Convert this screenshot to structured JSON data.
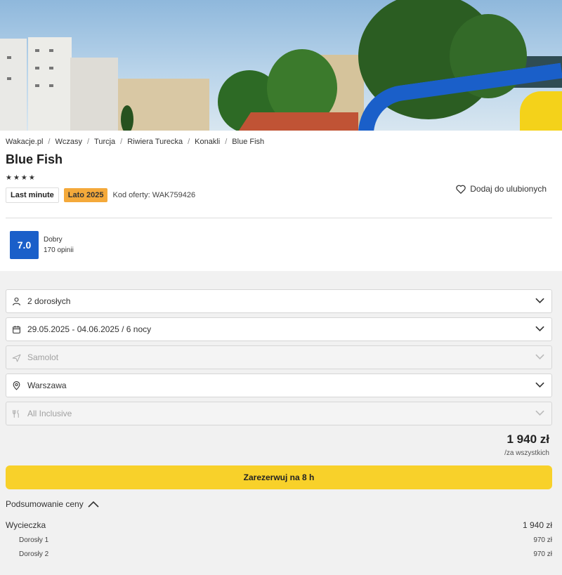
{
  "breadcrumb": [
    "Wakacje.pl",
    "Wczasy",
    "Turcja",
    "Riwiera Turecka",
    "Konakli",
    "Blue Fish"
  ],
  "hotel": {
    "name": "Blue Fish",
    "stars": "★★★★"
  },
  "tags": {
    "last_minute": "Last minute",
    "season": "Lato 2025",
    "offer_code": "Kod oferty: WAK759426"
  },
  "favorite": {
    "label": "Dodaj do ulubionych"
  },
  "rating": {
    "score": "7.0",
    "label": "Dobry",
    "reviews": "170 opinii"
  },
  "form": {
    "guests": "2 dorosłych",
    "dates": "29.05.2025 - 04.06.2025 / 6 nocy",
    "transport": "Samolot",
    "departure": "Warszawa",
    "board": "All Inclusive"
  },
  "price": {
    "amount": "1 940 zł",
    "per": "/za wszystkich"
  },
  "reserve": {
    "label": "Zarezerwuj na 8 h"
  },
  "summary": {
    "title": "Podsumowanie ceny",
    "trip_label": "Wycieczka",
    "trip_price": "1 940 zł",
    "rows": [
      {
        "label": "Dorosły 1",
        "price": "970 zł"
      },
      {
        "label": "Dorosły 2",
        "price": "970 zł"
      }
    ]
  },
  "colors": {
    "accent": "#1a5fc9",
    "reserve": "#f8d12a",
    "season_tag": "#f4a93a"
  }
}
